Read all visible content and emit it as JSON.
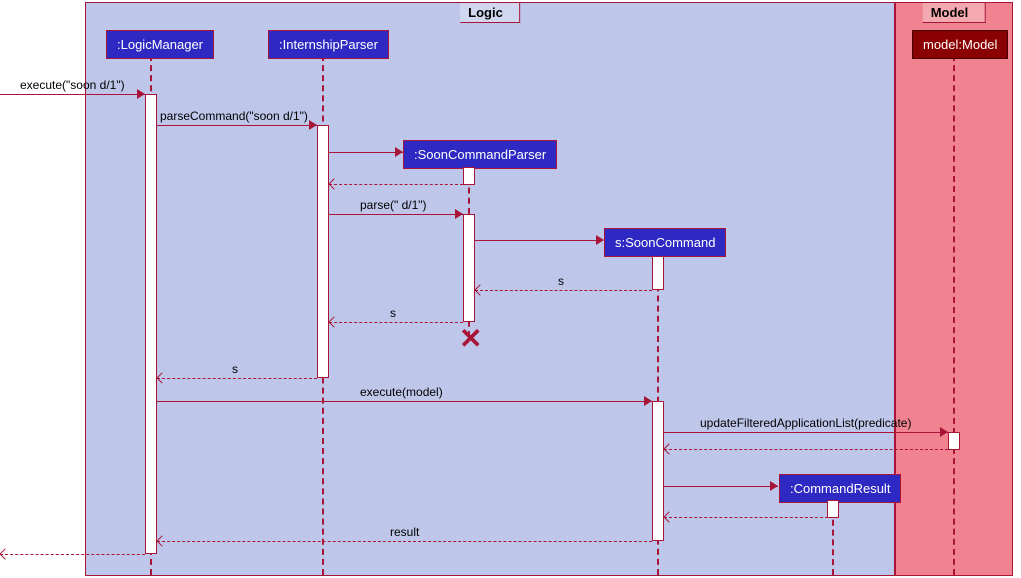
{
  "frames": {
    "logic": "Logic",
    "model": "Model"
  },
  "participants": {
    "logicManager": ":LogicManager",
    "internshipParser": ":InternshipParser",
    "soonCommandParser": ":SoonCommandParser",
    "soonCommand": "s:SoonCommand",
    "commandResult": ":CommandResult",
    "model": "model:Model"
  },
  "messages": {
    "execute1": "execute(\"soon d/1\")",
    "parseCommand": "parseCommand(\"soon d/1\")",
    "parse": "parse(\" d/1\")",
    "returnS1": "s",
    "returnS2": "s",
    "returnS3": "s",
    "executeModel": "execute(model)",
    "updateFiltered": "updateFilteredApplicationList(predicate)",
    "result": "result"
  },
  "colors": {
    "logicBg": "#bec6e9",
    "modelBg": "#f0838f",
    "border": "#a81538",
    "boxBlue": "#2d29c2",
    "boxRed": "#8b0000"
  }
}
